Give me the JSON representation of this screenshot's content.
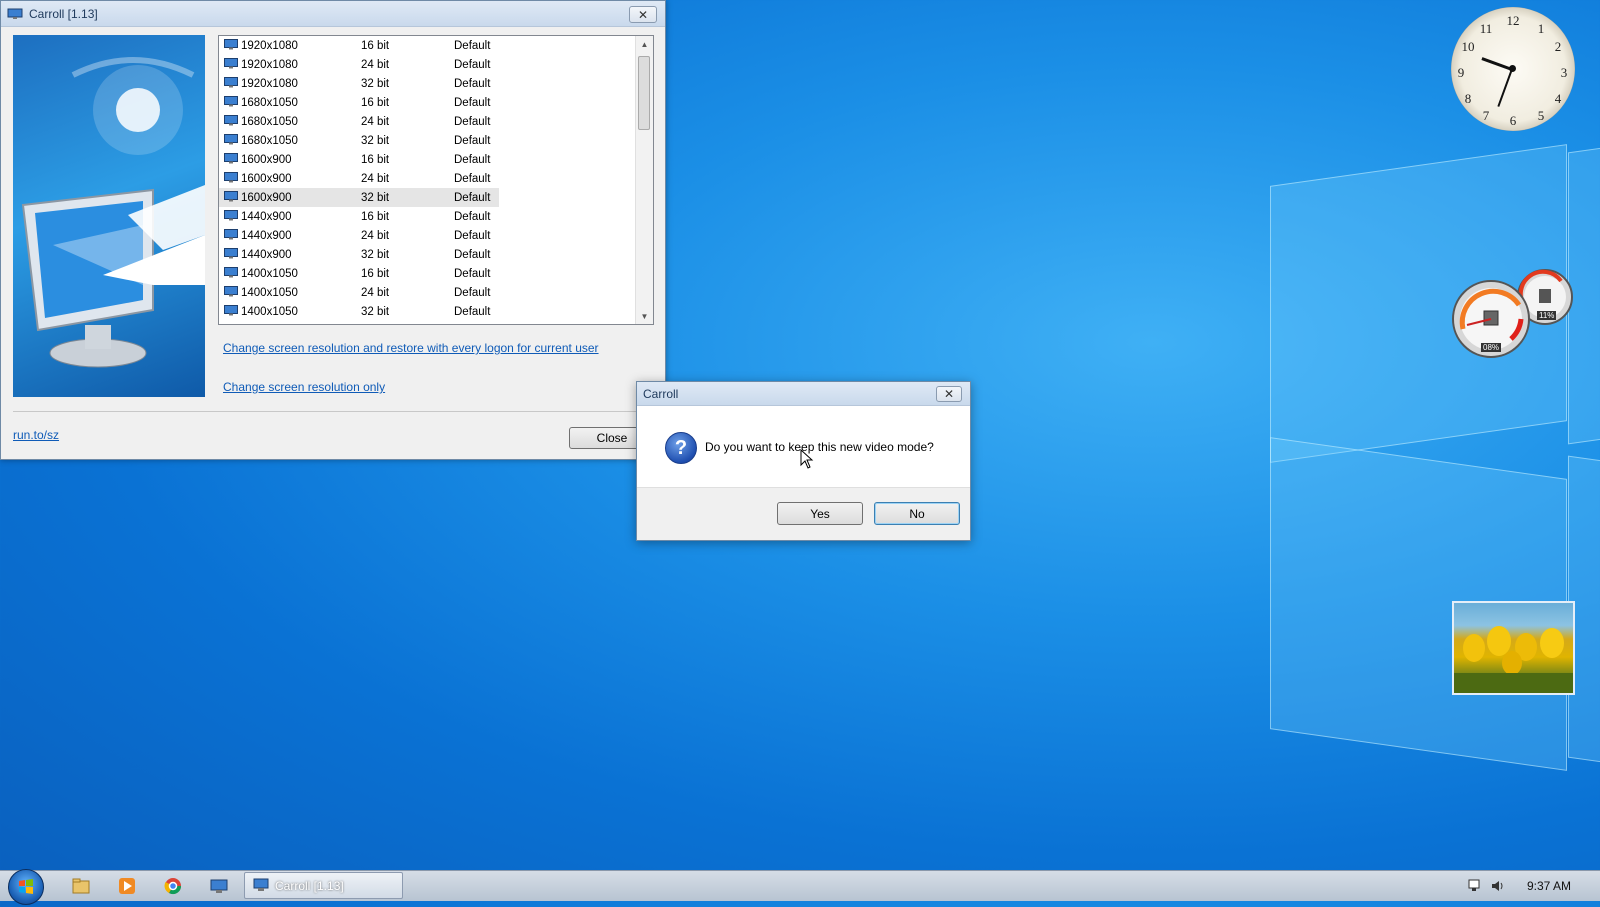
{
  "main_window": {
    "title": "Carroll [1.13]",
    "close_glyph": "✕",
    "modes": [
      {
        "res": "1920x1080",
        "bits": "16 bit",
        "freq": "Default"
      },
      {
        "res": "1920x1080",
        "bits": "24 bit",
        "freq": "Default"
      },
      {
        "res": "1920x1080",
        "bits": "32 bit",
        "freq": "Default"
      },
      {
        "res": "1680x1050",
        "bits": "16 bit",
        "freq": "Default"
      },
      {
        "res": "1680x1050",
        "bits": "24 bit",
        "freq": "Default"
      },
      {
        "res": "1680x1050",
        "bits": "32 bit",
        "freq": "Default"
      },
      {
        "res": "1600x900",
        "bits": "16 bit",
        "freq": "Default"
      },
      {
        "res": "1600x900",
        "bits": "24 bit",
        "freq": "Default"
      },
      {
        "res": "1600x900",
        "bits": "32 bit",
        "freq": "Default"
      },
      {
        "res": "1440x900",
        "bits": "16 bit",
        "freq": "Default"
      },
      {
        "res": "1440x900",
        "bits": "24 bit",
        "freq": "Default"
      },
      {
        "res": "1440x900",
        "bits": "32 bit",
        "freq": "Default"
      },
      {
        "res": "1400x1050",
        "bits": "16 bit",
        "freq": "Default"
      },
      {
        "res": "1400x1050",
        "bits": "24 bit",
        "freq": "Default"
      },
      {
        "res": "1400x1050",
        "bits": "32 bit",
        "freq": "Default"
      }
    ],
    "selected_mode_index": 8,
    "link_restore": "Change screen resolution and restore with every logon for current user",
    "link_only": "Change screen resolution only",
    "site_link": "run.to/sz",
    "close_button": "Close"
  },
  "dialog": {
    "title": "Carroll",
    "close_glyph": "✕",
    "icon": "question-icon",
    "icon_glyph": "?",
    "message": "Do you want to keep this new video mode?",
    "yes": "Yes",
    "no": "No"
  },
  "gadgets": {
    "clock_numbers": [
      "12",
      "1",
      "2",
      "3",
      "4",
      "5",
      "6",
      "7",
      "8",
      "9",
      "10",
      "11"
    ],
    "cpu_percent": "08%",
    "ram_percent": "11%"
  },
  "taskbar": {
    "task_label": "Carroll [1.13]",
    "time": "9:37 AM",
    "pinned": [
      "explorer-icon",
      "media-player-icon",
      "chrome-icon",
      "carroll-icon"
    ]
  },
  "colors": {
    "accent_link": "#0f5bb7",
    "desktop_blue": "#0a72d4"
  }
}
